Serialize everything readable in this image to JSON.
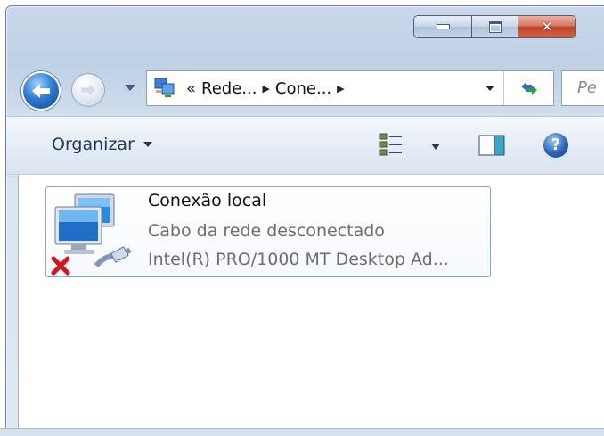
{
  "window": {
    "caption_buttons": {
      "minimize": "minimize",
      "maximize": "maximize",
      "close": "✕"
    }
  },
  "nav": {
    "address_prefix": "«",
    "breadcrumb": [
      "Rede...",
      "Cone..."
    ],
    "search_placeholder": "Pe"
  },
  "toolbar": {
    "organize_label": "Organizar"
  },
  "help": {
    "label": "?"
  },
  "connection": {
    "title": "Conexão local",
    "status": "Cabo da rede desconectado",
    "device": "Intel(R) PRO/1000 MT Desktop Ad...",
    "status_icon": "red-x-disconnected-icon"
  },
  "colors": {
    "accent": "#2f7fd4",
    "close_red": "#c04426",
    "item_border": "#8fa6c7"
  }
}
